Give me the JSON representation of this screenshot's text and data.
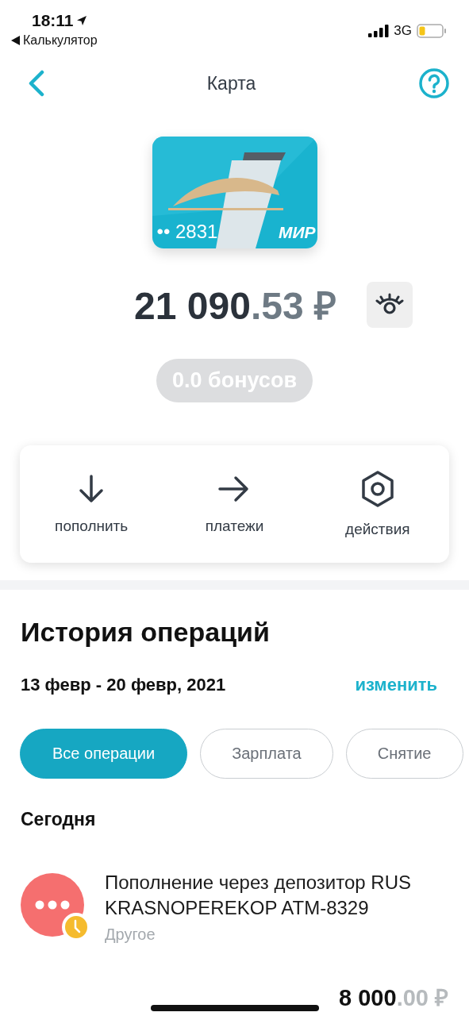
{
  "status_bar": {
    "time": "18:11",
    "back_app": "Калькулятор",
    "network": "3G"
  },
  "nav": {
    "title": "Карта"
  },
  "card": {
    "number": "•• 2831",
    "brand": "МИР"
  },
  "balance": {
    "whole": "21 090",
    "fraction": ".53 ₽",
    "hidden": false
  },
  "bonuses": "0.0 бонусов",
  "actions": [
    {
      "label": "пополнить",
      "kind": "topup"
    },
    {
      "label": "платежи",
      "kind": "payments"
    },
    {
      "label": "действия",
      "kind": "settings"
    }
  ],
  "history": {
    "title": "История операций",
    "period": "13 февр - 20 февр, 2021",
    "change": "изменить"
  },
  "filters": [
    {
      "label": "Все операции",
      "selected": true
    },
    {
      "label": "Зарплата",
      "selected": false
    },
    {
      "label": "Снятие",
      "selected": false
    }
  ],
  "day": "Сегодня",
  "transactions": [
    {
      "title": "Пополнение через депозитор RUS KRASNOPEREKOP ATM-8329",
      "category": "Другое",
      "amount_whole": "8 000",
      "amount_fraction": ".00 ₽",
      "color": "#f56f6f",
      "pending": true
    }
  ]
}
